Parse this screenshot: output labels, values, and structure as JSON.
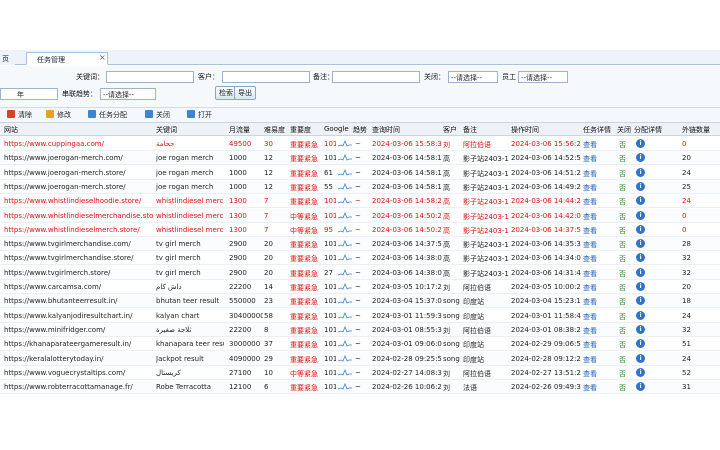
{
  "tabs": [
    {
      "label": "页"
    },
    {
      "label": "任务管理"
    }
  ],
  "tab_close": "×",
  "search": {
    "keyword_label": "关键词：",
    "client_label": "客户：",
    "note_label": "备注：",
    "focus_label": "关闭：",
    "focus_value": "--请选择--",
    "employee_label": "员工",
    "employee_value": "--请选择--",
    "year_value": "年",
    "status_label": "串联趋势：",
    "status_value": "--请选择--",
    "search_button": "检索",
    "export_button": "导出"
  },
  "toolbar": {
    "clear": "清除",
    "edit": "修改",
    "assign": "任务分配",
    "close": "关闭",
    "open": "打开"
  },
  "columns": {
    "site": "网站",
    "keyword": "关键词",
    "monthly": "月流量",
    "difficulty": "难易度",
    "importance": "重要度",
    "google": "Google",
    "trend": "趋势",
    "query_time": "查询时间",
    "client": "客户",
    "note": "备注",
    "op_time": "操作时间",
    "detail": "任务详情",
    "close": "关闭",
    "assign_detail": "分配详情",
    "links": "外链数量"
  },
  "colors": {
    "accent": "#2f74c9",
    "alert": "#e01010",
    "ok": "#2b8a2b"
  },
  "rows": [
    {
      "site": "https://www.cuppingaa.com/",
      "keyword": "جحامة",
      "monthly": "49500",
      "difficulty": "30",
      "importance": "重要紧急",
      "google": "101",
      "trend": "~",
      "query_time": "2024-03-06 15:58:32",
      "client": "刘",
      "note": "阿拉伯语",
      "op_time": "2024-03-06 15:56:24",
      "detail": "查看",
      "close": "否",
      "links": "0",
      "red": true
    },
    {
      "site": "https://www.joerogan-merch.com/",
      "keyword": "joe rogan merch",
      "monthly": "1000",
      "difficulty": "12",
      "importance": "重要紧急",
      "google": "101",
      "trend": "~",
      "query_time": "2024-03-06 14:58:13",
      "client": "高",
      "note": "影子站2403-1",
      "op_time": "2024-03-06 14:52:57",
      "detail": "查看",
      "close": "否",
      "links": "20",
      "red": false
    },
    {
      "site": "https://www.joerogan-merch.store/",
      "keyword": "joe rogan merch",
      "monthly": "1000",
      "difficulty": "12",
      "importance": "重要紧急",
      "google": "61",
      "trend": "~",
      "query_time": "2024-03-06 14:58:13",
      "client": "高",
      "note": "影子站2403-1",
      "op_time": "2024-03-06 14:51:23",
      "detail": "查看",
      "close": "否",
      "links": "24",
      "red": false
    },
    {
      "site": "https://www.joerogan-merch.store/",
      "keyword": "joe rogan merch",
      "monthly": "1000",
      "difficulty": "12",
      "importance": "重要紧急",
      "google": "55",
      "trend": "~",
      "query_time": "2024-03-06 14:58:18",
      "client": "高",
      "note": "影子站2403-1",
      "op_time": "2024-03-06 14:49:27",
      "detail": "查看",
      "close": "否",
      "links": "25",
      "red": false
    },
    {
      "site": "https://www.whistlindieselhoodie.store/",
      "keyword": "whistlindiesel merch",
      "monthly": "1300",
      "difficulty": "7",
      "importance": "重要紧急",
      "google": "101",
      "trend": "~",
      "query_time": "2024-03-06 14:58:23",
      "client": "高",
      "note": "影子站2403-1",
      "op_time": "2024-03-06 14:44:21",
      "detail": "查看",
      "close": "否",
      "links": "24",
      "red": true
    },
    {
      "site": "https://www.whistlindieselmerchandise.store/",
      "keyword": "whistlindiesel merch",
      "monthly": "1300",
      "difficulty": "7",
      "importance": "中等紧急",
      "google": "101",
      "trend": "~",
      "query_time": "2024-03-06 14:50:25",
      "client": "高",
      "note": "影子站2403-1",
      "op_time": "2024-03-06 14:42:07",
      "detail": "查看",
      "close": "否",
      "links": "0",
      "red": true
    },
    {
      "site": "https://www.whistlindieselmerch.store/",
      "keyword": "whistlindiesel merch",
      "monthly": "1300",
      "difficulty": "7",
      "importance": "中等紧急",
      "google": "95",
      "trend": "~",
      "query_time": "2024-03-06 14:50:26",
      "client": "高",
      "note": "影子站2403-1",
      "op_time": "2024-03-06 14:37:58",
      "detail": "查看",
      "close": "否",
      "links": "0",
      "red": true
    },
    {
      "site": "https://www.tvgirlmerchandise.com/",
      "keyword": "tv girl merch",
      "monthly": "2900",
      "difficulty": "20",
      "importance": "重要紧急",
      "google": "101",
      "trend": "~",
      "query_time": "2024-03-06 14:37:57",
      "client": "高",
      "note": "影子站2403-1",
      "op_time": "2024-03-06 14:35:39",
      "detail": "查看",
      "close": "否",
      "links": "28",
      "red": false
    },
    {
      "site": "https://www.tvgirlmerchandise.store/",
      "keyword": "tv girl merch",
      "monthly": "2900",
      "difficulty": "20",
      "importance": "重要紧急",
      "google": "101",
      "trend": "~",
      "query_time": "2024-03-06 14:38:00",
      "client": "高",
      "note": "影子站2403-1",
      "op_time": "2024-03-06 14:34:07",
      "detail": "查看",
      "close": "否",
      "links": "32",
      "red": false
    },
    {
      "site": "https://www.tvgirlmerch.store/",
      "keyword": "tv girl merch",
      "monthly": "2900",
      "difficulty": "20",
      "importance": "重要紧急",
      "google": "27",
      "trend": "~",
      "query_time": "2024-03-06 14:38:03",
      "client": "高",
      "note": "影子站2403-1",
      "op_time": "2024-03-06 14:31:42",
      "detail": "查看",
      "close": "否",
      "links": "32",
      "red": false
    },
    {
      "site": "https://www.carcamsa.com/",
      "keyword": "داش كام",
      "monthly": "22200",
      "difficulty": "14",
      "importance": "重要紧急",
      "google": "101",
      "trend": "~",
      "query_time": "2024-03-05 10:17:21",
      "client": "刘",
      "note": "阿拉伯语",
      "op_time": "2024-03-05 10:00:22",
      "detail": "查看",
      "close": "否",
      "links": "20",
      "red": false
    },
    {
      "site": "https://www.bhutanteerresult.in/",
      "keyword": "bhutan teer result",
      "monthly": "550000",
      "difficulty": "23",
      "importance": "重要紧急",
      "google": "101",
      "trend": "~",
      "query_time": "2024-03-04 15:37:04",
      "client": "song",
      "note": "印度站",
      "op_time": "2024-03-04 15:23:11",
      "detail": "查看",
      "close": "否",
      "links": "18",
      "red": false
    },
    {
      "site": "https://www.kalyanjodiresultchart.in/",
      "keyword": "kalyan chart",
      "monthly": "30400000",
      "difficulty": "58",
      "importance": "重要紧急",
      "google": "101",
      "trend": "~",
      "query_time": "2024-03-01 11:59:35",
      "client": "song",
      "note": "印度站",
      "op_time": "2024-03-01 11:58:49",
      "detail": "查看",
      "close": "否",
      "links": "24",
      "red": false
    },
    {
      "site": "https://www.minifridger.com/",
      "keyword": "ثلاجة صغيرة",
      "monthly": "22200",
      "difficulty": "8",
      "importance": "重要紧急",
      "google": "101",
      "trend": "~",
      "query_time": "2024-03-01 08:55:30",
      "client": "刘",
      "note": "阿拉伯语",
      "op_time": "2024-03-01 08:38:27",
      "detail": "查看",
      "close": "否",
      "links": "32",
      "red": false
    },
    {
      "site": "https://khanaparateergameresult.in/",
      "keyword": "khanapara teer result",
      "monthly": "3000000",
      "difficulty": "37",
      "importance": "重要紧急",
      "google": "101",
      "trend": "~",
      "query_time": "2024-03-01 09:06:02",
      "client": "song",
      "note": "印度站",
      "op_time": "2024-02-29 09:06:53",
      "detail": "查看",
      "close": "否",
      "links": "51",
      "red": false
    },
    {
      "site": "https://keralalotterytoday.in/",
      "keyword": "Jackpot result",
      "monthly": "4090000",
      "difficulty": "29",
      "importance": "重要紧急",
      "google": "101",
      "trend": "~",
      "query_time": "2024-02-28 09:25:53",
      "client": "song",
      "note": "印度站",
      "op_time": "2024-02-28 09:12:25",
      "detail": "查看",
      "close": "否",
      "links": "24",
      "red": false
    },
    {
      "site": "https://www.voguecrystaltips.com/",
      "keyword": "كريستال",
      "monthly": "27100",
      "difficulty": "10",
      "importance": "中等紧急",
      "google": "101",
      "trend": "~",
      "query_time": "2024-02-27 14:08:39",
      "client": "刘",
      "note": "阿拉伯语",
      "op_time": "2024-02-27 13:51:21",
      "detail": "查看",
      "close": "否",
      "links": "52",
      "red": false
    },
    {
      "site": "https://www.robterracottamanage.fr/",
      "keyword": "Robe Terracotta",
      "monthly": "12100",
      "difficulty": "6",
      "importance": "重要紧急",
      "google": "101",
      "trend": "~",
      "query_time": "2024-02-26 10:06:23",
      "client": "刘",
      "note": "法语",
      "op_time": "2024-02-26 09:49:39",
      "detail": "查看",
      "close": "否",
      "links": "31",
      "red": false
    }
  ]
}
